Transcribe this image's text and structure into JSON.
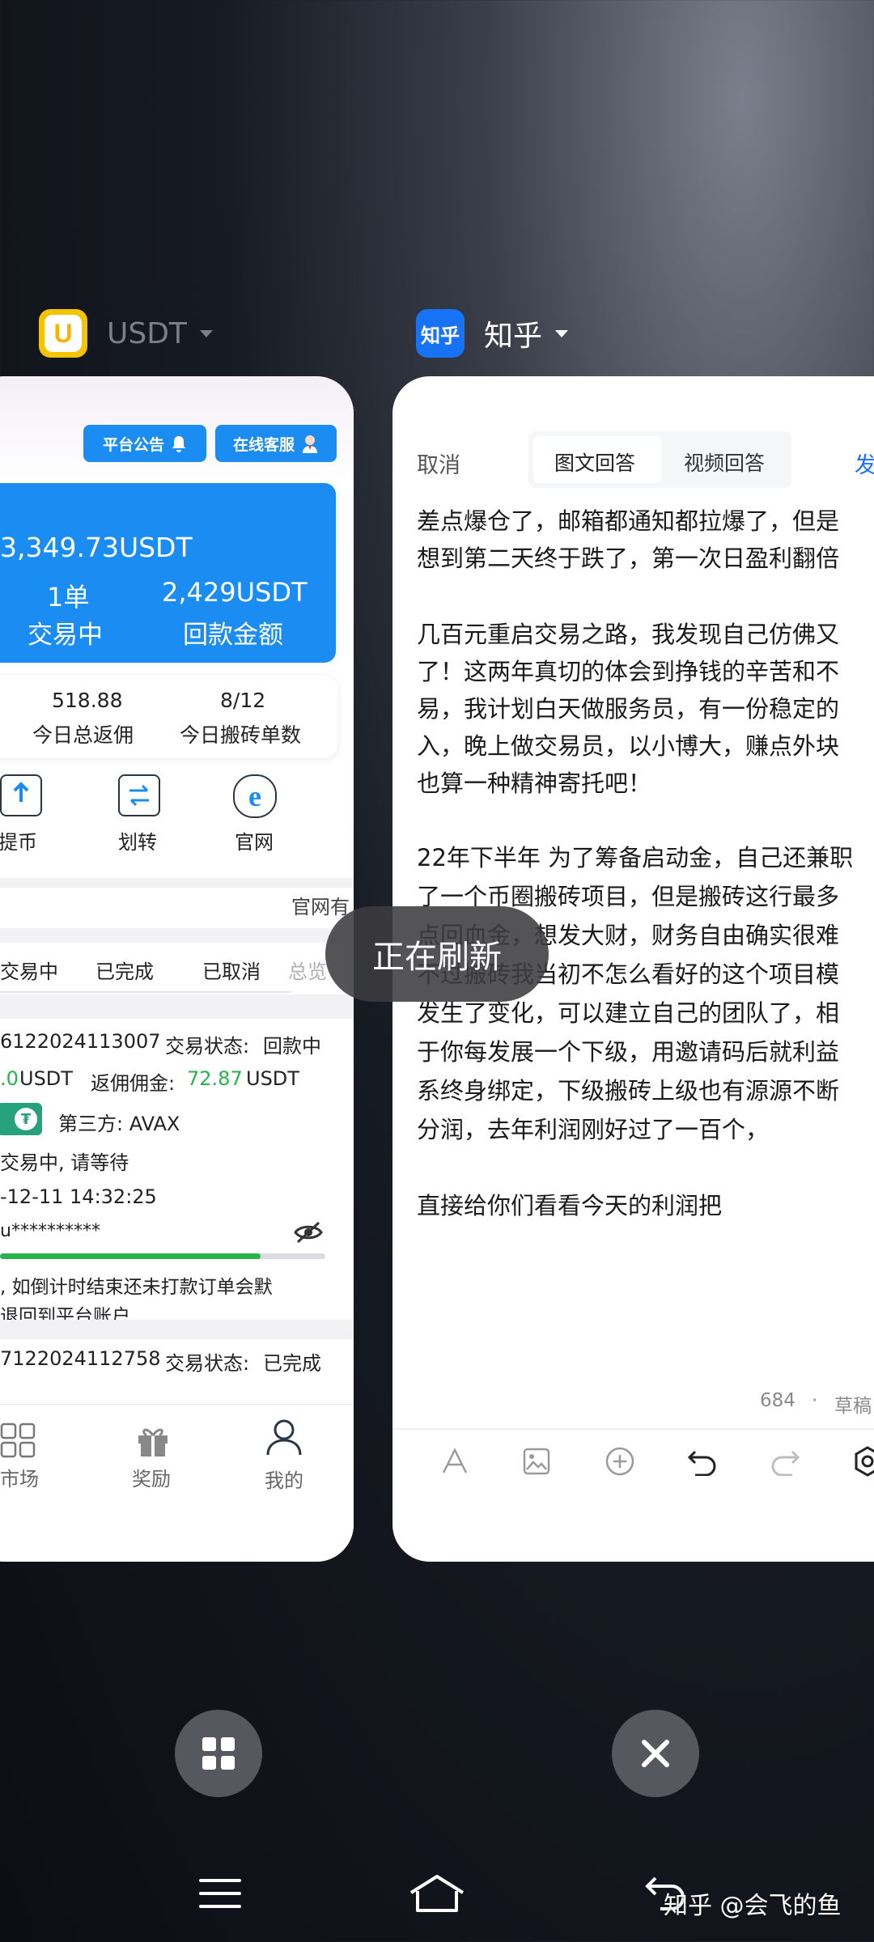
{
  "apps": {
    "usdt": {
      "name": "USDT",
      "icon_letter": "U",
      "accent": "#1a8cf2"
    },
    "zhihu": {
      "name": "知乎",
      "icon_label": "知乎",
      "accent": "#1772f6"
    }
  },
  "usdt_screen": {
    "notice_button": "平台公告",
    "service_button": "在线客服",
    "balance": "3,349.73USDT",
    "orders_value": "1单",
    "orders_label": "交易中",
    "refund_value": "2,429USDT",
    "refund_label": "回款金额",
    "stats": [
      {
        "value": "518.88",
        "label": "今日总返佣"
      },
      {
        "value": "8/12",
        "label": "今日搬砖单数"
      }
    ],
    "actions": [
      {
        "label": "提币",
        "icon": "upload-icon"
      },
      {
        "label": "划转",
        "icon": "transfer-icon"
      },
      {
        "label": "官网",
        "icon": "browser-icon"
      }
    ],
    "official_site_text": "官网有",
    "tabs": [
      "交易中",
      "已完成",
      "已取消",
      "总览"
    ],
    "order1": {
      "id": "6122024113007",
      "status_label": "交易状态:",
      "status": "回款中",
      "amount_prefix": ".0",
      "amount_unit": "USDT",
      "commission_label": "返佣佣金:",
      "commission_value": "72.87",
      "commission_unit": "USDT",
      "third_party": "第三方: AVAX",
      "state": "交易中, 请等待",
      "time": "-12-11 14:32:25",
      "account": "u**********",
      "progress": 0.8,
      "note_line1": ", 如倒计时结束还未打款订单会默",
      "note_line2": "退回到平台账户"
    },
    "order2": {
      "id": "7122024112758",
      "status_label": "交易状态:",
      "status": "已完成"
    },
    "bottom_nav": [
      "市场",
      "奖励",
      "我的"
    ]
  },
  "zhihu_screen": {
    "cancel": "取消",
    "tab_text_answer": "图文回答",
    "tab_video_answer": "视频回答",
    "publish": "发",
    "paragraphs": [
      [
        "差点爆仓了，邮箱都通知都拉爆了，但是",
        "想到第二天终于跌了，第一次日盈利翻倍"
      ],
      [
        " 几百元重启交易之路，我发现自己仿佛又",
        "了！这两年真切的体会到挣钱的辛苦和不",
        "易，我计划白天做服务员，有一份稳定的",
        "入，晚上做交易员，以小博大，赚点外块",
        "也算一种精神寄托吧！"
      ],
      [
        "22年下半年 为了筹备启动金，自己还兼职",
        "了一个币圈搬砖项目，但是搬砖这行最多",
        "点回血金，想发大财，财务自由确实很难",
        "不过搬砖我当初不怎么看好的这个项目模",
        "发生了变化，可以建立自己的团队了，相",
        "于你每发展一个下级，用邀请码后就利益",
        "系终身绑定，下级搬砖上级也有源源不断",
        "分润，去年利润刚好过了一百个，"
      ],
      [
        "直接给你们看看今天的利润把"
      ]
    ],
    "word_count": "684",
    "separator": "·",
    "draft": "草稿"
  },
  "refresh_toast": "正在刷新",
  "watermark": "知乎 @会飞的鱼"
}
